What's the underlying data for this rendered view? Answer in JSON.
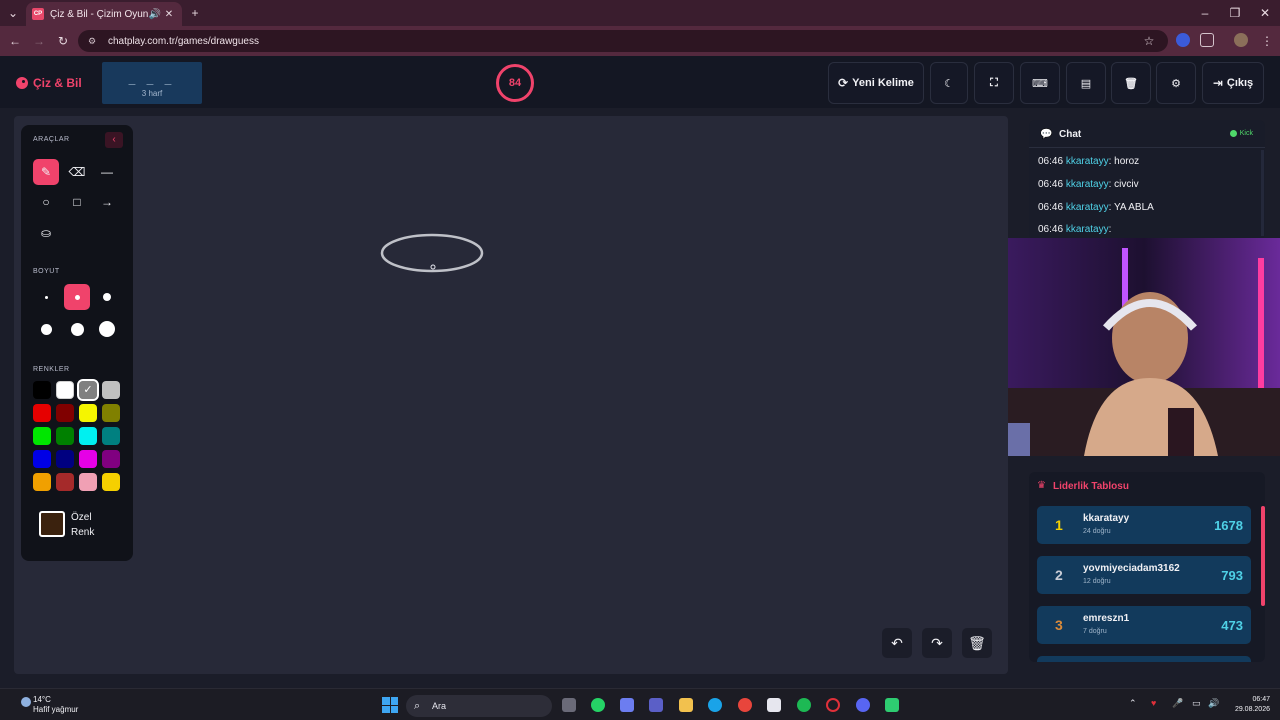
{
  "browser": {
    "tab_title": "Çiz & Bil - Çizim Oyunu",
    "tab_favicon_text": "CP",
    "url": "chatplay.com.tr/games/drawguess"
  },
  "header": {
    "brand": "Çiz & Bil",
    "word_blanks": "_ _ _",
    "word_hint": "3 harf",
    "timer": "84",
    "new_word_label": "Yeni Kelime",
    "exit_label": "Çıkış"
  },
  "tools": {
    "title": "ARAÇLAR",
    "size_title": "BOYUT",
    "colors_title": "RENKLER",
    "custom_color_label_line1": "Özel",
    "custom_color_label_line2": "Renk",
    "palette": [
      "#000000",
      "#ffffff",
      "#808080",
      "#c0c0c0",
      "#e60000",
      "#800000",
      "#f5f500",
      "#808000",
      "#00e600",
      "#008000",
      "#00f0f0",
      "#008080",
      "#0000e6",
      "#000080",
      "#e600e6",
      "#800080",
      "#f0a000",
      "#a52a2a",
      "#f0a0b4",
      "#f5d000"
    ],
    "selected_color": "#808080",
    "custom_color": "#3b220e"
  },
  "chat": {
    "title": "Chat",
    "platform": "Kick",
    "messages": [
      {
        "time": "06:46",
        "user": "kkaratayy",
        "text": ": horoz"
      },
      {
        "time": "06:46",
        "user": "kkaratayy",
        "text": ": civciv"
      },
      {
        "time": "06:46",
        "user": "kkaratayy",
        "text": ": YA ABLA"
      },
      {
        "time": "06:46",
        "user": "kkaratayy",
        "text": ":"
      }
    ]
  },
  "leaderboard": {
    "title": "Liderlik Tablosu",
    "rows": [
      {
        "rank": "1",
        "name": "kkaratayy",
        "sub": "24 doğru",
        "score": "1678",
        "rank_color": "#f5d000"
      },
      {
        "rank": "2",
        "name": "yovmiyeciadam3162",
        "sub": "12 doğru",
        "score": "793",
        "rank_color": "#c8ccd6"
      },
      {
        "rank": "3",
        "name": "emreszn1",
        "sub": "7 doğru",
        "score": "473",
        "rank_color": "#d98a3a"
      }
    ]
  },
  "taskbar": {
    "temperature": "14°C",
    "weather": "Hafif yağmur",
    "search_placeholder": "Ara",
    "time": "06:47",
    "date": "29.08.2026"
  },
  "colors": {
    "accent": "#f0436b",
    "cyan": "#4fd1e6",
    "panel": "#191c29"
  }
}
